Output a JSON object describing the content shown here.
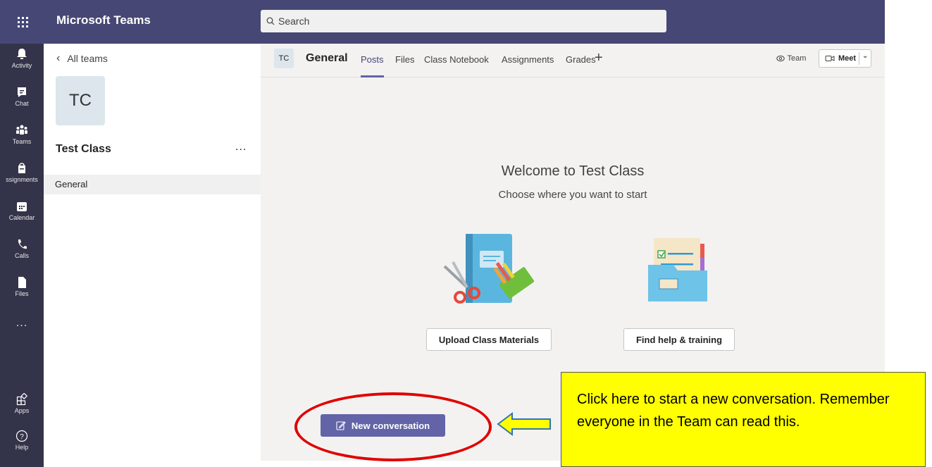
{
  "topbar": {
    "app_title": "Microsoft Teams",
    "search_placeholder": "Search"
  },
  "rail": {
    "items": [
      {
        "label": "Activity",
        "icon": "bell-icon"
      },
      {
        "label": "Chat",
        "icon": "chat-icon"
      },
      {
        "label": "Teams",
        "icon": "teams-icon"
      },
      {
        "label": "ssignments",
        "icon": "assignments-icon"
      },
      {
        "label": "Calendar",
        "icon": "calendar-icon"
      },
      {
        "label": "Calls",
        "icon": "phone-icon"
      },
      {
        "label": "Files",
        "icon": "file-icon"
      },
      {
        "label": "...",
        "icon": "more-icon"
      },
      {
        "label": "Apps",
        "icon": "apps-icon"
      },
      {
        "label": "Help",
        "icon": "help-icon"
      }
    ]
  },
  "panel": {
    "back_label": "All teams",
    "team_initials": "TC",
    "team_name": "Test Class",
    "more_label": "...",
    "channels": [
      "General"
    ]
  },
  "main": {
    "channel_initials": "TC",
    "channel_name": "General",
    "tabs": [
      "Posts",
      "Files",
      "Class Notebook",
      "Assignments",
      "Grades"
    ],
    "add_tab": "+",
    "team_button": "Team",
    "meet_button": "Meet",
    "welcome_title": "Welcome to Test Class",
    "welcome_subtitle": "Choose where you want to start",
    "upload_button": "Upload Class Materials",
    "help_button": "Find help & training",
    "new_conversation_button": "New conversation"
  },
  "annotation": {
    "callout_text": "Click here to start a new conversation. Remember everyone in the Team can read this.",
    "ellipse_color": "#e00000",
    "callout_color": "#ffff00"
  },
  "colors": {
    "topbar": "#464775",
    "rail": "#33344a",
    "accent": "#6264a7"
  }
}
